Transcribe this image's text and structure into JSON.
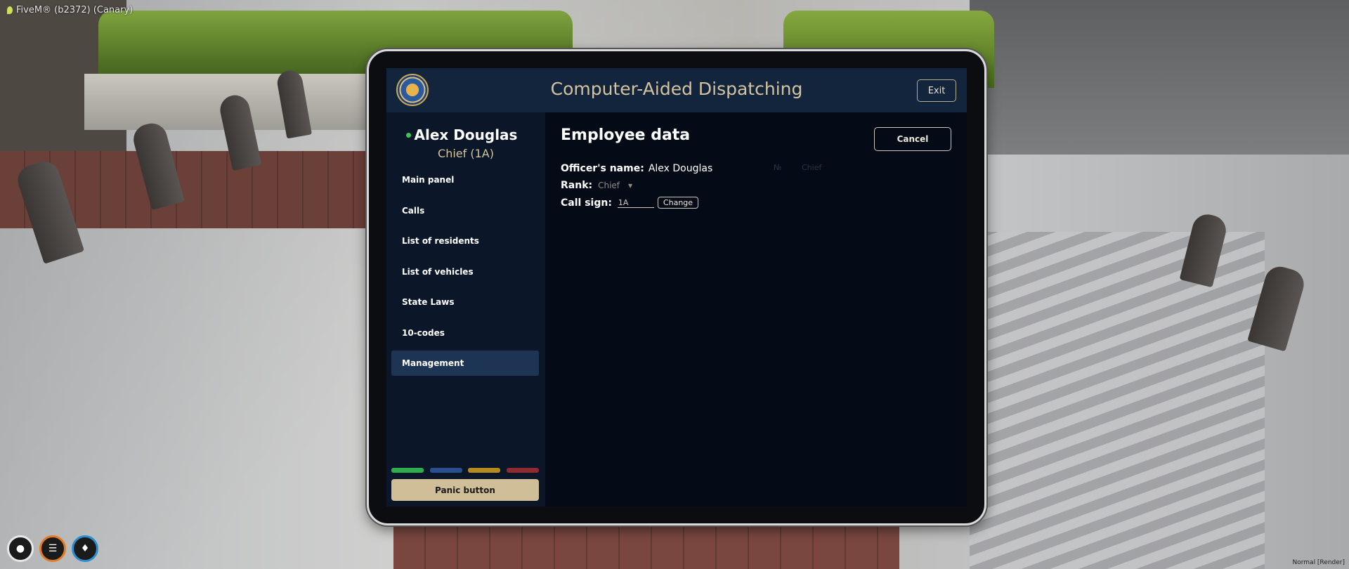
{
  "window": {
    "title": "FiveM® (b2372) (Canary)"
  },
  "build_tag": "Normal [Render]",
  "hud": {
    "icons": [
      "microphone-icon",
      "food-icon",
      "water-drop-icon"
    ],
    "colors": {
      "mic": "#e8e8e8",
      "food": "#e57a22",
      "water": "#2c8ed2"
    }
  },
  "cad": {
    "title": "Computer-Aided Dispatching",
    "exit_label": "Exit",
    "user": {
      "name": "Alex Douglas",
      "rank_line": "Chief (1A)",
      "status_color": "#3ec45a"
    },
    "nav": [
      {
        "label": "Main panel",
        "active": false
      },
      {
        "label": "Calls",
        "active": false
      },
      {
        "label": "List of residents",
        "active": false
      },
      {
        "label": "List of vehicles",
        "active": false
      },
      {
        "label": "State Laws",
        "active": false
      },
      {
        "label": "10-codes",
        "active": false
      },
      {
        "label": "Management",
        "active": true
      }
    ],
    "status_colors": [
      "#2fae4f",
      "#2a4f8f",
      "#b48b1f",
      "#8e2a30"
    ],
    "panic_label": "Panic button",
    "content": {
      "title": "Employee data",
      "cancel_label": "Cancel",
      "officer_name_label": "Officer's name:",
      "officer_name": "Alex Douglas",
      "rank_label": "Rank:",
      "rank_value": "Chief",
      "call_sign_label": "Call sign:",
      "call_sign_value": "1A",
      "change_label": "Change",
      "ghost_col_1": "№",
      "ghost_col_2": "Chief"
    },
    "accent_color": "#d3c4a0"
  }
}
